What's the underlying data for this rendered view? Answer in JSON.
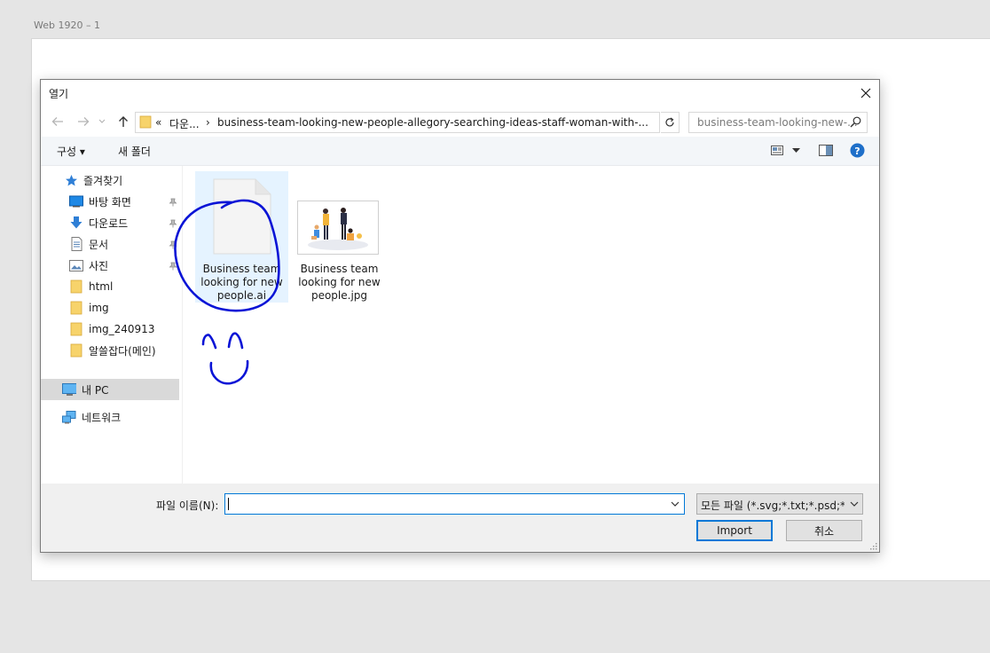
{
  "artboard": {
    "label": "Web 1920 – 1"
  },
  "dialog": {
    "title": "열기",
    "breadcrumb": {
      "overflow": "«",
      "parent": "다운...",
      "separator": "›",
      "current": "business-team-looking-new-people-allegory-searching-ideas-staff-woman-with-..."
    },
    "search_placeholder": "business-team-looking-new-...",
    "toolbar": {
      "organize_label": "구성 ▾",
      "new_folder_label": "새 폴더"
    },
    "nav": {
      "quick_access": "즐겨찾기",
      "items": [
        {
          "label": "바탕 화면",
          "icon": "desktop-icon",
          "pinned": true
        },
        {
          "label": "다운로드",
          "icon": "download-arrow-icon",
          "pinned": true
        },
        {
          "label": "문서",
          "icon": "document-icon",
          "pinned": true
        },
        {
          "label": "사진",
          "icon": "pictures-icon",
          "pinned": true
        },
        {
          "label": "html",
          "icon": "folder-icon",
          "pinned": false
        },
        {
          "label": "img",
          "icon": "folder-icon",
          "pinned": false
        },
        {
          "label": "img_240913",
          "icon": "folder-icon",
          "pinned": false
        },
        {
          "label": "알쓸잡다(메인)",
          "icon": "folder-icon",
          "pinned": false
        }
      ],
      "this_pc": "내 PC",
      "network": "네트워크"
    },
    "files": [
      {
        "name": "Business team looking for new people.ai",
        "line1": "Business team",
        "line2": "looking for new",
        "line3": "people.ai",
        "selected": true
      },
      {
        "name": "Business team looking for new people.jpg",
        "line1": "Business team",
        "line2": "looking for new",
        "line3": "people.jpg",
        "selected": false
      }
    ],
    "bottom": {
      "filename_label": "파일 이름(N):",
      "filename_value": "",
      "filetype_value": "모든 파일 (*.svg;*.txt;*.psd;*.ai;",
      "import_label": "Import",
      "cancel_label": "취소"
    }
  },
  "colors": {
    "accent": "#0078d7",
    "annotation_ink": "#0a14d6",
    "selected_bg": "#e5f3ff",
    "folder_yellow": "#f7d36b"
  }
}
